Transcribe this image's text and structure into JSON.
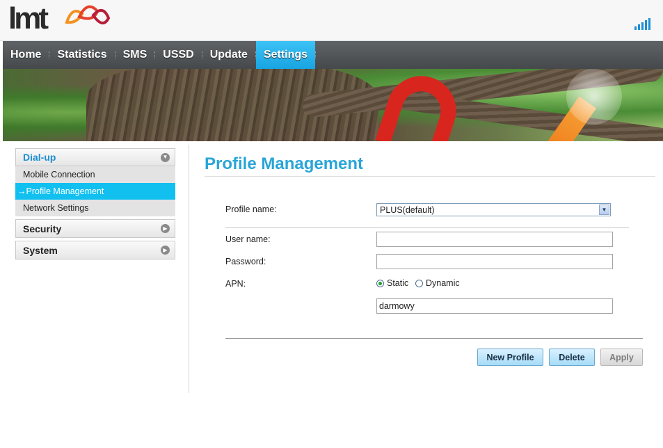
{
  "header": {
    "logo_text": "lmt",
    "signal_icon": "signal-bars-icon",
    "colors": {
      "signal": "#1a8fd6",
      "accent": "#2aa5d8"
    }
  },
  "nav": {
    "items": [
      {
        "label": "Home"
      },
      {
        "label": "Statistics"
      },
      {
        "label": "SMS"
      },
      {
        "label": "USSD"
      },
      {
        "label": "Update"
      },
      {
        "label": "Settings"
      }
    ],
    "active": "Settings"
  },
  "sidebar": {
    "dialup": {
      "label": "Dial-up",
      "items": [
        {
          "label": "Mobile Connection"
        },
        {
          "label": "Profile Management"
        },
        {
          "label": "Network Settings"
        }
      ],
      "active_prefix": "→"
    },
    "security": {
      "label": "Security"
    },
    "system": {
      "label": "System"
    }
  },
  "main": {
    "title": "Profile Management",
    "profile_label": "Profile name:",
    "profile_value": "PLUS(default)",
    "username_label": "User name:",
    "username_value": "",
    "password_label": "Password:",
    "password_value": "",
    "apn_label": "APN:",
    "apn_options": {
      "static": "Static",
      "dynamic": "Dynamic"
    },
    "apn_selected": "Static",
    "apn_value": "darmowy",
    "buttons": {
      "new_profile": "New Profile",
      "delete": "Delete",
      "apply": "Apply"
    }
  }
}
